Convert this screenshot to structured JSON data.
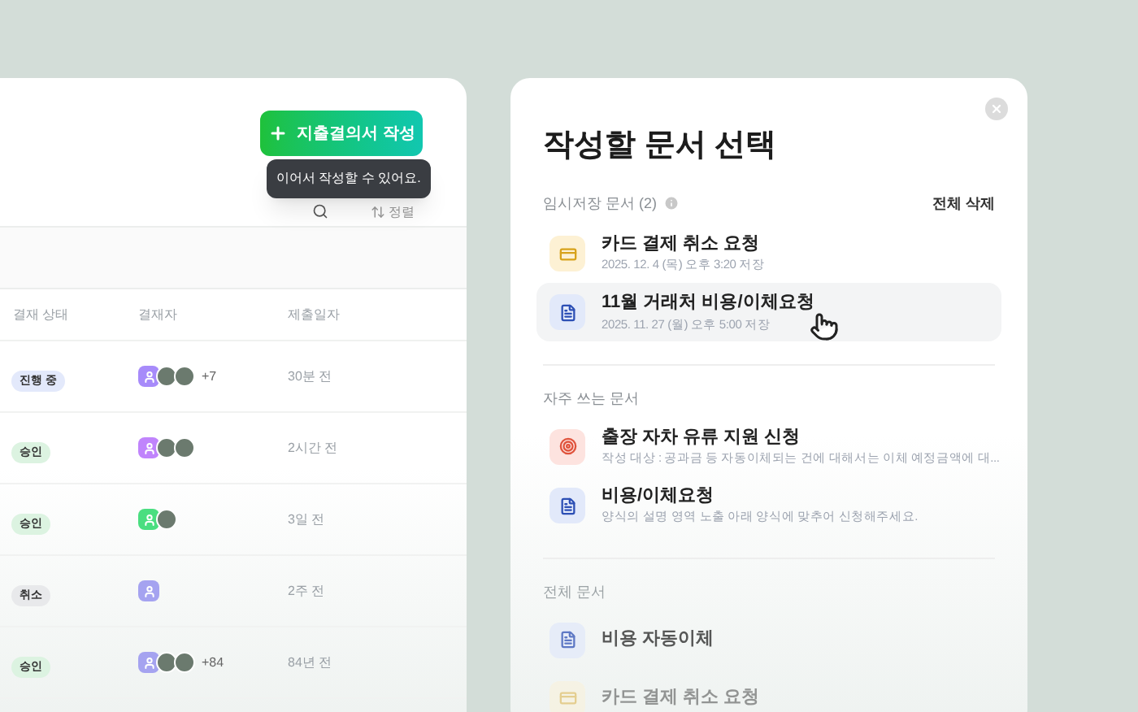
{
  "create_button": {
    "label": "지출결의서 작성"
  },
  "tooltip": {
    "text": "이어서 작성할 수 있어요."
  },
  "toolbar": {
    "sort_label": "정렬"
  },
  "table": {
    "columns": [
      "결재 상태",
      "결재자",
      "제출일자"
    ],
    "rows": [
      {
        "status": {
          "text": "진행 중",
          "color": "#e3e9fb"
        },
        "approvers": [
          {
            "kind": "user",
            "color": "#a78bfa"
          },
          {
            "kind": "photo"
          },
          {
            "kind": "photo"
          }
        ],
        "extra": "+7",
        "submitted": "30분 전"
      },
      {
        "status": {
          "text": "승인",
          "color": "#dcf3e1"
        },
        "approvers": [
          {
            "kind": "user",
            "color": "#c084fc"
          },
          {
            "kind": "photo"
          },
          {
            "kind": "photo"
          }
        ],
        "submitted": "2시간 전"
      },
      {
        "status": {
          "text": "승인",
          "color": "#dcf3e1"
        },
        "approvers": [
          {
            "kind": "user",
            "color": "#4ade80"
          },
          {
            "kind": "photo"
          }
        ],
        "submitted": "3일 전"
      },
      {
        "status": {
          "text": "취소",
          "color": "#e8e9eb"
        },
        "approvers": [
          {
            "kind": "user",
            "color": "#a5a3f0"
          }
        ],
        "submitted": "2주 전"
      },
      {
        "status": {
          "text": "승인",
          "color": "#dcf3e1"
        },
        "approvers": [
          {
            "kind": "user",
            "color": "#a5a3f0"
          },
          {
            "kind": "photo"
          },
          {
            "kind": "photo"
          }
        ],
        "extra": "+84",
        "submitted": "84년 전"
      }
    ]
  },
  "modal": {
    "title": "작성할 문서 선택",
    "drafts": {
      "label": "임시저장 문서 (2)",
      "action": "전체 삭제",
      "items": [
        {
          "kind": "card",
          "title": "카드 결제 취소 요청",
          "subtitle": "2025. 12. 4 (목) 오후 3:20 저장",
          "hovered": false
        },
        {
          "kind": "doc",
          "title": "11월 거래처 비용/이체요청",
          "subtitle": "2025. 11. 27 (월) 오후 5:00 저장",
          "hovered": true
        }
      ]
    },
    "frequent": {
      "label": "자주 쓰는 문서",
      "items": [
        {
          "kind": "target",
          "title": "출장 자차 유류 지원 신청",
          "subtitle": "작성 대상 : 공과금 등 자동이체되는 건에 대해서는 이체 예정금액에 대..."
        },
        {
          "kind": "doc",
          "title": "비용/이체요청",
          "subtitle": "양식의 설명 영역 노출 아래 양식에 맞추어 신청해주세요."
        }
      ]
    },
    "all": {
      "label": "전체 문서",
      "items": [
        {
          "kind": "doc",
          "title": "비용 자동이체"
        },
        {
          "kind": "card",
          "title": "카드 결제 취소 요청"
        }
      ]
    }
  }
}
